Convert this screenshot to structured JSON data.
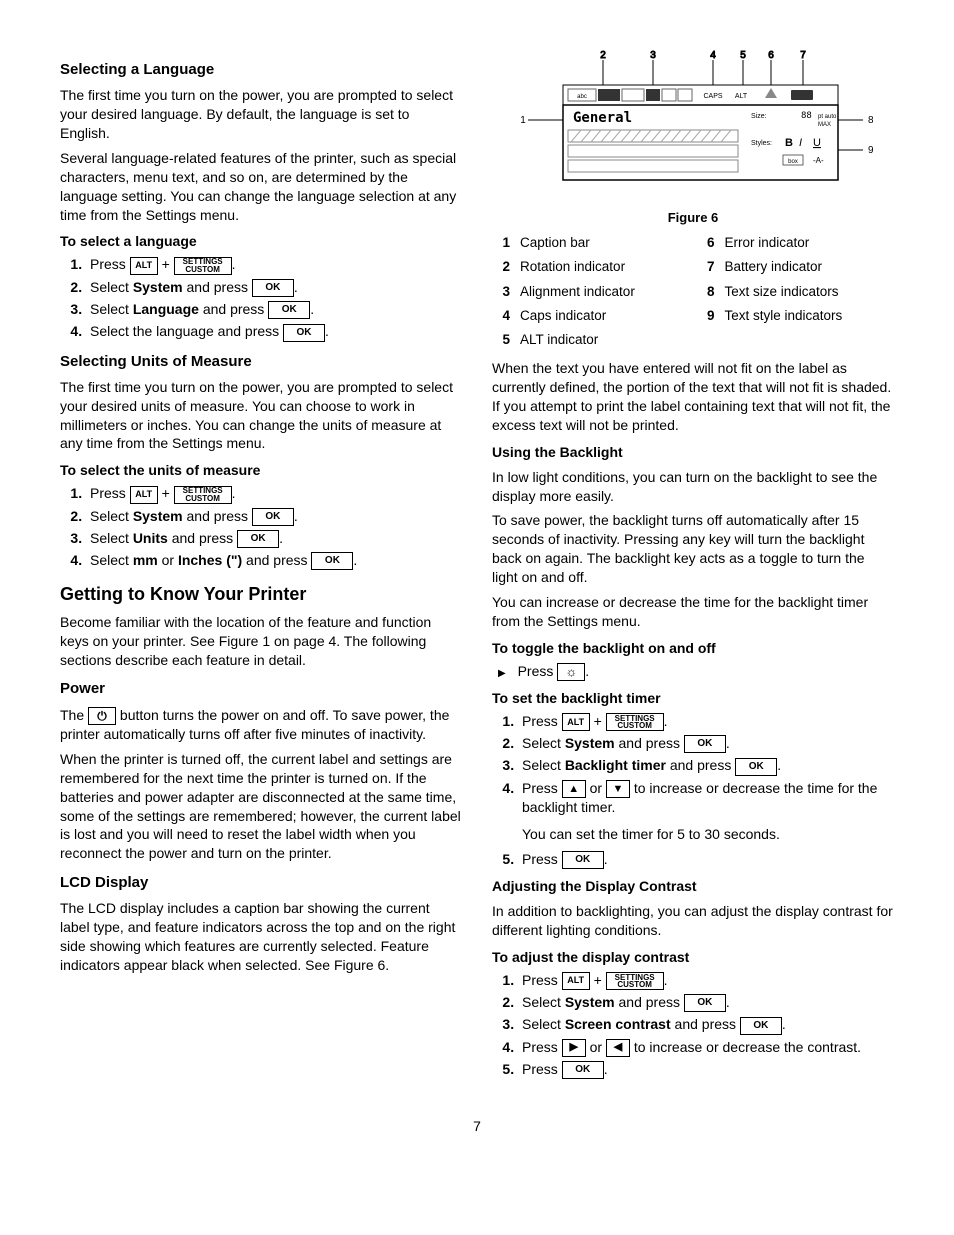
{
  "left": {
    "selLang": {
      "h": "Selecting a Language",
      "p1": "The first time you turn on the power, you are prompted to select your desired language. By default, the language is set to English.",
      "p2": "Several language-related features of the printer, such as special characters, menu text, and so on, are determined by the language setting. You can change the language selection at any time from the Settings menu.",
      "h4": "To select a language",
      "s1a": "Press ",
      "s2a": "Select ",
      "s2b": "System",
      "s2c": " and press ",
      "s3a": "Select ",
      "s3b": "Language",
      "s3c": " and press ",
      "s4a": "Select the language and press "
    },
    "selUnits": {
      "h": "Selecting Units of Measure",
      "p1": "The first time you turn on the power, you are prompted to select your desired units of measure. You can choose to work in millimeters or inches. You can change the units of measure at any time from the Settings menu.",
      "h4": "To select the units of measure",
      "s1a": "Press ",
      "s2a": "Select ",
      "s2b": "System",
      "s2c": " and press ",
      "s3a": "Select ",
      "s3b": "Units",
      "s3c": " and press ",
      "s4a": "Select ",
      "s4b": "mm",
      "s4c": " or ",
      "s4d": "Inches (\")",
      "s4e": " and press "
    },
    "getting": {
      "h": "Getting to Know Your Printer",
      "p1": "Become familiar with the location of the feature and function keys on your printer. See Figure 1 on page 4. The following sections describe each feature in detail."
    },
    "power": {
      "h": "Power",
      "p1a": "The ",
      "p1b": " button turns the power on and off. To save power, the printer automatically turns off after five minutes of inactivity.",
      "p2": "When the printer is turned off, the current label and settings are remembered for the next time the printer is turned on. If the batteries and power adapter are disconnected at the same time, some of the settings are remembered; however, the current label is lost and you will need to reset the label width when you reconnect the power and turn on the printer."
    },
    "lcd": {
      "h": "LCD Display",
      "p1": "The LCD display includes a caption bar showing the current label type, and feature indicators across the top and on the right side showing which features are currently selected. Feature indicators appear black when selected. See Figure 6."
    }
  },
  "right": {
    "figCaption": "Figure 6",
    "legend": {
      "1": "Caption bar",
      "6": "Error indicator",
      "2": "Rotation indicator",
      "7": "Battery indicator",
      "3": "Alignment indicator",
      "8": "Text size indicators",
      "4": "Caps indicator",
      "9": "Text style indicators",
      "5": "ALT indicator"
    },
    "pAfterFig": "When the text you have entered will not fit on the label as currently defined, the portion of the text that will not fit is shaded. If you attempt to print the label containing text that will not fit, the excess text will not be printed.",
    "backlight": {
      "h": "Using the Backlight",
      "p1": "In low light conditions, you can turn on the backlight to see the display more easily.",
      "p2": "To save power, the backlight turns off automatically after 15 seconds of inactivity. Pressing any key will turn the backlight back on again. The backlight key acts as a toggle to turn the light on and off.",
      "p3": "You can increase or decrease the time for the backlight timer from the Settings menu.",
      "toggleH": "To toggle the backlight on and off",
      "toggleStep": "Press ",
      "timerH": "To set the backlight timer",
      "t1": "Press ",
      "t2a": "Select ",
      "t2b": "System",
      "t2c": " and press ",
      "t3a": "Select ",
      "t3b": "Backlight timer",
      "t3c": " and press ",
      "t4a": "Press ",
      "t4b": " or ",
      "t4c": " to increase or decrease the time for the backlight timer.",
      "t4note": "You can set the timer for 5 to 30 seconds.",
      "t5": "Press "
    },
    "contrast": {
      "h": "Adjusting the Display Contrast",
      "p1": "In addition to backlighting, you can adjust the display contrast for different lighting conditions.",
      "adjH": "To adjust the display contrast",
      "c1": "Press ",
      "c2a": "Select ",
      "c2b": "System",
      "c2c": " and press ",
      "c3a": "Select ",
      "c3b": "Screen contrast",
      "c3c": " and press ",
      "c4a": "Press ",
      "c4b": " or ",
      "c4c": " to increase or decrease the contrast.",
      "c5": "Press "
    }
  },
  "keys": {
    "alt": "ALT",
    "settings": "SETTINGS\nCUSTOM",
    "ok": "OK",
    "power": "⏻",
    "light": "☼",
    "up": "▲",
    "down": "▼",
    "left": "◀",
    "right": "▶"
  },
  "pageNum": "7"
}
